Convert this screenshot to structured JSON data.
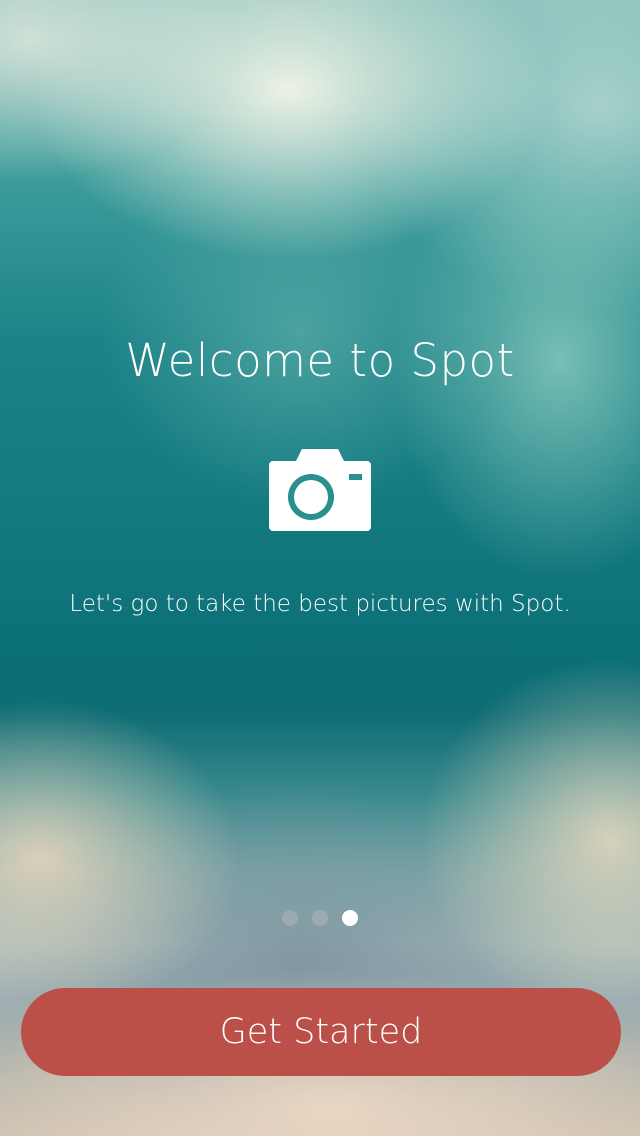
{
  "welcome": {
    "title": "Welcome to Spot",
    "icon": "camera-icon",
    "subtitle": "Let's go to take the best pictures with Spot."
  },
  "pagination": {
    "total_pages": 3,
    "current_page": 3
  },
  "cta": {
    "label": "Get Started",
    "color": "#bb5049"
  },
  "colors": {
    "accent": "#bb5049",
    "text": "#ffffff",
    "background_primary": "#0f6f74"
  }
}
